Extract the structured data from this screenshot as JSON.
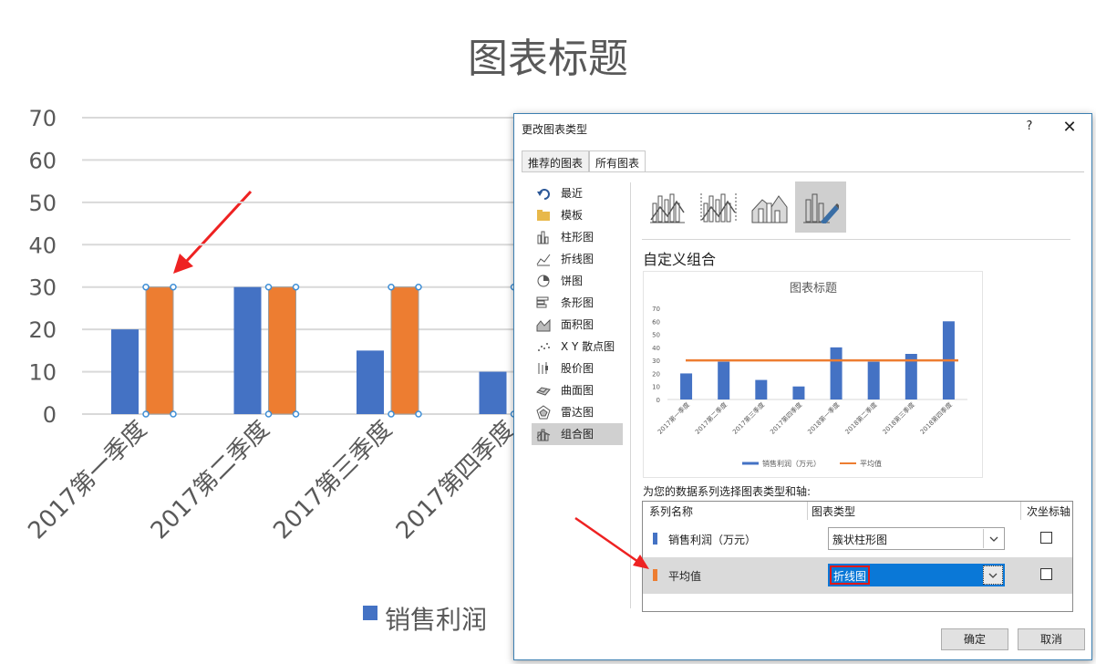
{
  "chart_data": [
    {
      "type": "bar",
      "title": "图表标题",
      "categories": [
        "2017第一季度",
        "2017第二季度",
        "2017第三季度",
        "2017第四季度"
      ],
      "series": [
        {
          "name": "销售利润",
          "values": [
            20,
            30,
            15,
            10
          ],
          "color": "#4472c4"
        },
        {
          "values": [
            30,
            30,
            30,
            30
          ],
          "color": "#ed7d31",
          "selected": true
        }
      ],
      "yticks": [
        "0",
        "10",
        "20",
        "30",
        "40",
        "50",
        "60",
        "70"
      ],
      "ylim": [
        0,
        70
      ],
      "grid": true,
      "legend": "bottom"
    },
    {
      "type": "bar",
      "title": "图表标题",
      "categories": [
        "2017第一季度",
        "2017第二季度",
        "2017第三季度",
        "2017第四季度",
        "2018第一季度",
        "2018第二季度",
        "2018第三季度",
        "2018第四季度"
      ],
      "series": [
        {
          "name": "销售利润（万元）",
          "values": [
            20,
            29,
            15,
            10,
            40,
            29,
            35,
            60
          ],
          "color": "#4472c4"
        },
        {
          "name": "平均值",
          "values": [
            30,
            30,
            30,
            30,
            30,
            30,
            30,
            30
          ],
          "color": "#ed7d31",
          "render": "line"
        }
      ],
      "yticks": [
        "0",
        "10",
        "20",
        "30",
        "40",
        "50",
        "60",
        "70"
      ],
      "ylim": [
        0,
        70
      ],
      "grid": false,
      "legend": "bottom"
    }
  ],
  "dialog": {
    "title": "更改图表类型",
    "help": "?",
    "close": "✕",
    "tabs": [
      {
        "label": "推荐的图表",
        "active": false
      },
      {
        "label": "所有图表",
        "active": true
      }
    ],
    "sidebar": [
      {
        "label": "最近",
        "icon": "undo-icon"
      },
      {
        "label": "模板",
        "icon": "folder-icon"
      },
      {
        "label": "柱形图",
        "icon": "column-chart-icon"
      },
      {
        "label": "折线图",
        "icon": "line-chart-icon"
      },
      {
        "label": "饼图",
        "icon": "pie-chart-icon"
      },
      {
        "label": "条形图",
        "icon": "bar-chart-icon"
      },
      {
        "label": "面积图",
        "icon": "area-chart-icon"
      },
      {
        "label": "X Y 散点图",
        "icon": "scatter-chart-icon"
      },
      {
        "label": "股价图",
        "icon": "stock-chart-icon"
      },
      {
        "label": "曲面图",
        "icon": "surface-chart-icon"
      },
      {
        "label": "雷达图",
        "icon": "radar-chart-icon"
      },
      {
        "label": "组合图",
        "icon": "combo-chart-icon",
        "active": true
      }
    ],
    "subtype_icons": [
      "combo-column-line-icon",
      "combo-column-line-secondary-icon",
      "combo-area-column-icon",
      "combo-custom-icon"
    ],
    "combo_title": "自定义组合",
    "series_hint": "为您的数据系列选择图表类型和轴:",
    "grid_headers": {
      "name": "系列名称",
      "type": "图表类型",
      "secondary": "次坐标轴"
    },
    "rows": [
      {
        "name": "销售利润（万元）",
        "color": "#4472c4",
        "type": "簇状柱形图",
        "secondary": false,
        "selected": false
      },
      {
        "name": "平均值",
        "color": "#ed7d31",
        "type": "折线图",
        "secondary": false,
        "selected": true
      }
    ],
    "ok": "确定",
    "cancel": "取消"
  }
}
